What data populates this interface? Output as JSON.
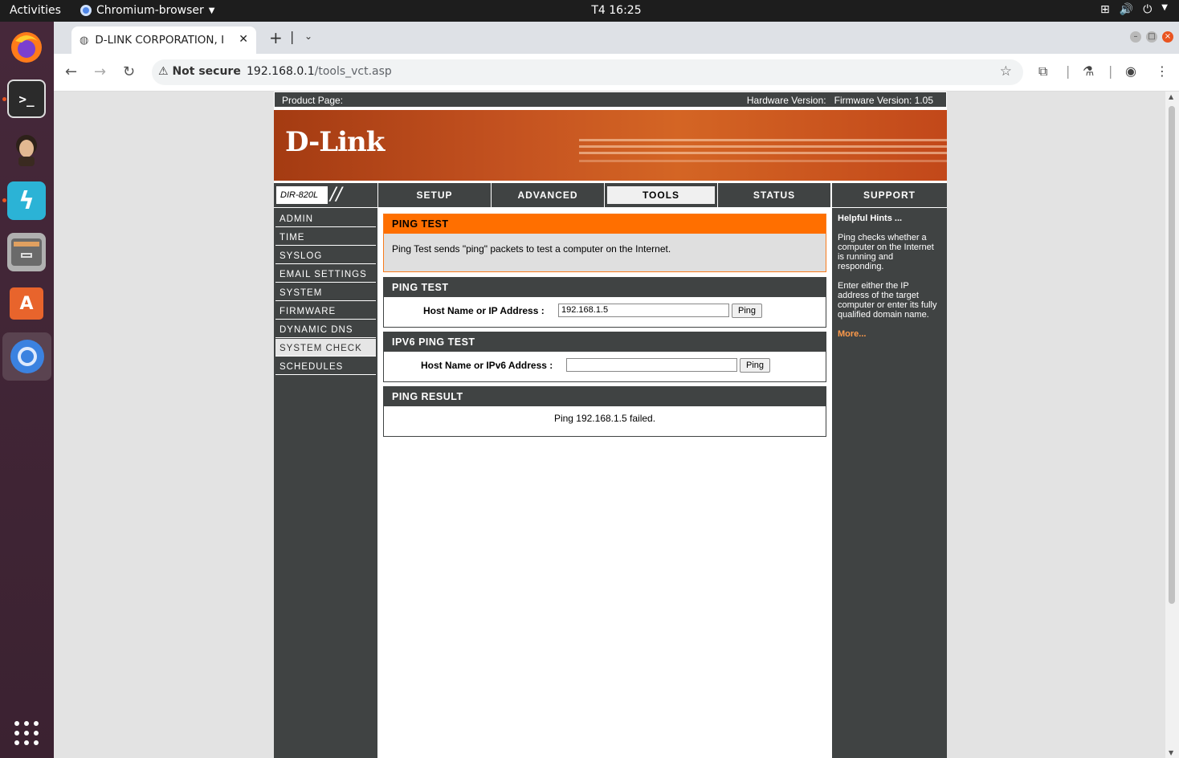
{
  "system": {
    "activities": "Activities",
    "app_name": "Chromium-browser",
    "clock": "T4 16:25"
  },
  "browser": {
    "tab_title": "D-LINK CORPORATION, I",
    "security": "Not secure",
    "url_host": "192.168.0.1",
    "url_path": "/tools_vct.asp"
  },
  "router": {
    "product_page": "Product Page:",
    "hardware_version": "Hardware Version:",
    "firmware_version": "Firmware Version: 1.05",
    "logo": "D-Link",
    "model": "DIR-820L",
    "nav_tabs": [
      "SETUP",
      "ADVANCED",
      "TOOLS",
      "STATUS",
      "SUPPORT"
    ],
    "active_tab": "TOOLS",
    "left_menu": [
      "ADMIN",
      "TIME",
      "SYSLOG",
      "EMAIL SETTINGS",
      "SYSTEM",
      "FIRMWARE",
      "DYNAMIC DNS",
      "SYSTEM CHECK",
      "SCHEDULES"
    ],
    "active_menu": "SYSTEM CHECK"
  },
  "main": {
    "intro_title": "PING TEST",
    "intro_text": "Ping Test sends \"ping\" packets to test a computer on the Internet.",
    "ping_title": "PING TEST",
    "ping_label": "Host Name or IP Address  :",
    "ping_value": "192.168.1.5",
    "ping_button": "Ping",
    "ipv6_title": "IPV6 PING TEST",
    "ipv6_label": "Host Name or IPv6 Address  :",
    "ipv6_value": "",
    "ipv6_button": "Ping",
    "result_title": "PING RESULT",
    "result_text": "Ping 192.168.1.5 failed."
  },
  "hints": {
    "title": "Helpful Hints ...",
    "p1": "Ping checks whether a computer on the Internet is running and responding.",
    "p2": "Enter either the IP address of the target computer or enter its fully qualified domain name.",
    "more": "More..."
  },
  "colors": {
    "accent_orange": "#ff6f00",
    "panel_dark": "#404343",
    "dock": "#46283a"
  }
}
